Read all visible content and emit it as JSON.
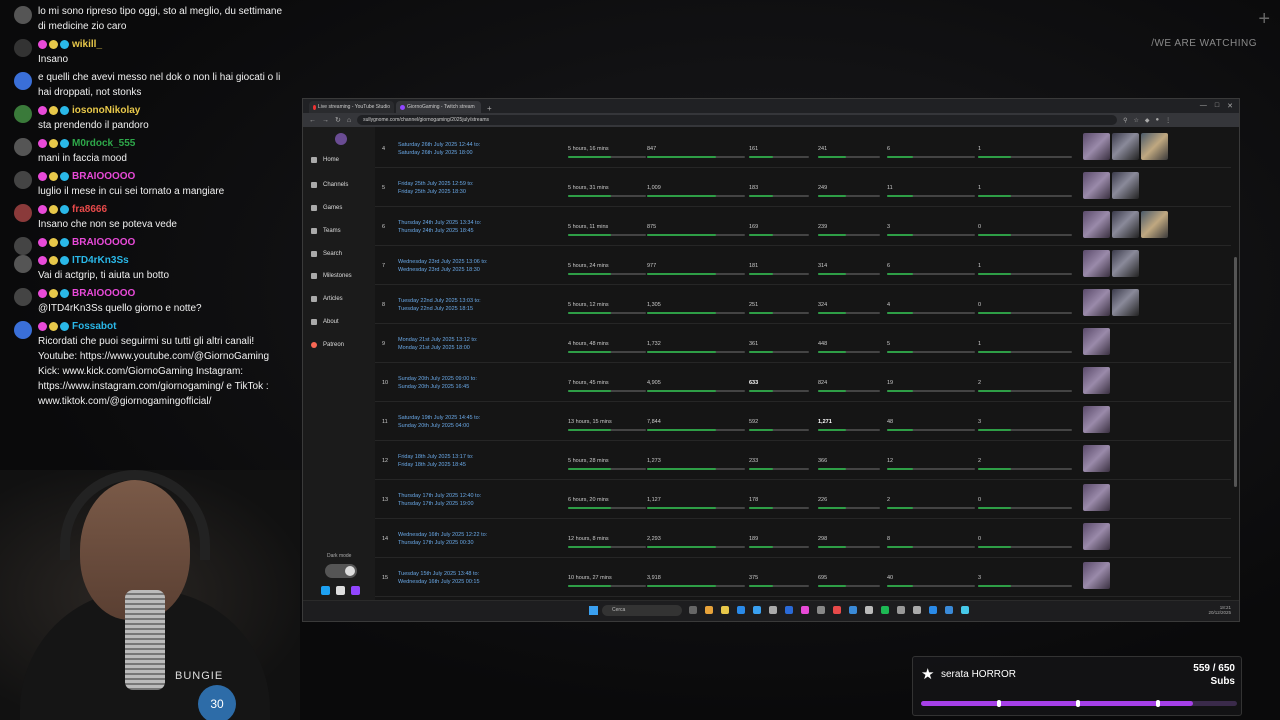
{
  "watermark": "/WE ARE WATCHING",
  "chat": [
    {
      "user": "",
      "color": "#ffffff",
      "text": "lo mi sono ripreso tipo oggi, sto al meglio, du settimane di medicine zio caro",
      "badge_color": "#555"
    },
    {
      "user": "wikill_",
      "color": "#e8c84a",
      "text": "Insano",
      "badge_color": "#333"
    },
    {
      "user": "",
      "color": "#ffffff",
      "text": "e quelli che avevi messo nel dok o non li hai giocati o li hai droppati, not stonks",
      "badge_color": "#3a6fd8"
    },
    {
      "user": "iosonoNikolay",
      "color": "#e8c84a",
      "text": "sta prendendo il pandoro",
      "badge_color": "#3a7a3a"
    },
    {
      "user": "M0rdock_555",
      "color": "#2ea84a",
      "text": "mani in faccia mood",
      "badge_color": "#555"
    },
    {
      "user": "BRAIOOOOO",
      "color": "#e84ad8",
      "text": "luglio il mese in cui sei tornato a mangiare",
      "badge_color": "#444"
    },
    {
      "user": "fra8666",
      "color": "#e84a4a",
      "text": "Insano che non se poteva vede",
      "badge_color": "#8a3a3a"
    },
    {
      "user": "BRAIOOOOO",
      "color": "#e84ad8",
      "text": "",
      "badge_color": "#444"
    },
    {
      "user": "ITD4rKn3Ss",
      "color": "#2ab8e8",
      "text": "Vai di actgrip, ti aiuta un botto",
      "badge_color": "#555"
    },
    {
      "user": "BRAIOOOOO",
      "color": "#e84ad8",
      "text": "@ITD4rKn3Ss quello giorno e notte?",
      "badge_color": "#444"
    },
    {
      "user": "Fossabot",
      "color": "#2ab8e8",
      "text": "Ricordati che puoi seguirmi su tutti gli altri canali! Youtube: https://www.youtube.com/@GiornoGaming Kick: www.kick.com/GiornoGaming Instagram: https://www.instagram.com/giornogaming/ e TikTok : www.tiktok.com/@giornogamingofficial/",
      "badge_color": "#3a6fd8"
    }
  ],
  "cam": {
    "logo": "BUNGIE",
    "badge": "30"
  },
  "browser": {
    "tabs": [
      {
        "label": "Live streaming - YouTube Studio",
        "fav": "#e33"
      },
      {
        "label": "GiornoGaming - Twitch stream",
        "fav": "#9146ff"
      }
    ],
    "new_tab": "+",
    "url": "sullygnome.com/channel/giornogaming/2025july/streams"
  },
  "sidebar": {
    "items": [
      "Home",
      "Channels",
      "Games",
      "Teams",
      "Search",
      "Milestones",
      "Articles",
      "About",
      "Patreon"
    ],
    "dark_mode": "Dark mode"
  },
  "streams": [
    {
      "n": "4",
      "start": "Saturday 26th July 2025 12:44 to:",
      "end": "Saturday 26th July 2025 18:00",
      "length": "5 hours, 16 mins",
      "avg": "847",
      "a": "161",
      "b": "241",
      "c": "6",
      "d": "1",
      "thumbs": 3
    },
    {
      "n": "5",
      "start": "Friday 25th July 2025 12:59 to:",
      "end": "Friday 25th July 2025 18:30",
      "length": "5 hours, 31 mins",
      "avg": "1,009",
      "a": "183",
      "b": "249",
      "c": "11",
      "d": "1",
      "thumbs": 2
    },
    {
      "n": "6",
      "start": "Thursday 24th July 2025 13:34 to:",
      "end": "Thursday 24th July 2025 18:45",
      "length": "5 hours, 11 mins",
      "avg": "875",
      "a": "169",
      "b": "239",
      "c": "3",
      "d": "0",
      "thumbs": 3
    },
    {
      "n": "7",
      "start": "Wednesday 23rd July 2025 13:06 to:",
      "end": "Wednesday 23rd July 2025 18:30",
      "length": "5 hours, 24 mins",
      "avg": "977",
      "a": "181",
      "b": "314",
      "c": "6",
      "d": "1",
      "thumbs": 2
    },
    {
      "n": "8",
      "start": "Tuesday 22nd July 2025 13:03 to:",
      "end": "Tuesday 22nd July 2025 18:15",
      "length": "5 hours, 12 mins",
      "avg": "1,305",
      "a": "251",
      "b": "324",
      "c": "4",
      "d": "0",
      "thumbs": 2
    },
    {
      "n": "9",
      "start": "Monday 21st July 2025 13:12 to:",
      "end": "Monday 21st July 2025 18:00",
      "length": "4 hours, 48 mins",
      "avg": "1,732",
      "a": "361",
      "b": "448",
      "c": "5",
      "d": "1",
      "thumbs": 1
    },
    {
      "n": "10",
      "start": "Sunday 20th July 2025 09:00 to:",
      "end": "Sunday 20th July 2025 16:45",
      "length": "7 hours, 45 mins",
      "avg": "4,905",
      "a": "633",
      "b": "824",
      "c": "19",
      "d": "2",
      "thumbs": 1,
      "bold_a": true
    },
    {
      "n": "11",
      "start": "Saturday 19th July 2025 14:45 to:",
      "end": "Sunday 20th July 2025 04:00",
      "length": "13 hours, 15 mins",
      "avg": "7,844",
      "a": "592",
      "b": "1,271",
      "c": "48",
      "d": "3",
      "thumbs": 1,
      "bold_b": true
    },
    {
      "n": "12",
      "start": "Friday 18th July 2025 13:17 to:",
      "end": "Friday 18th July 2025 18:45",
      "length": "5 hours, 28 mins",
      "avg": "1,273",
      "a": "233",
      "b": "366",
      "c": "12",
      "d": "2",
      "thumbs": 1
    },
    {
      "n": "13",
      "start": "Thursday 17th July 2025 12:40 to:",
      "end": "Thursday 17th July 2025 19:00",
      "length": "6 hours, 20 mins",
      "avg": "1,127",
      "a": "178",
      "b": "226",
      "c": "2",
      "d": "0",
      "thumbs": 1
    },
    {
      "n": "14",
      "start": "Wednesday 16th July 2025 12:22 to:",
      "end": "Thursday 17th July 2025 00:30",
      "length": "12 hours, 8 mins",
      "avg": "2,293",
      "a": "189",
      "b": "298",
      "c": "8",
      "d": "0",
      "thumbs": 1
    },
    {
      "n": "15",
      "start": "Tuesday 15th July 2025 13:48 to:",
      "end": "Wednesday 16th July 2025 00:15",
      "length": "10 hours, 27 mins",
      "avg": "3,918",
      "a": "375",
      "b": "695",
      "c": "40",
      "d": "3",
      "thumbs": 1
    }
  ],
  "taskbar": {
    "search": "Cerca",
    "time": "18:21",
    "date": "20/12/2025"
  },
  "goal": {
    "title": "serata HORROR",
    "count": "559 / 650",
    "unit": "Subs",
    "progress": 0.86
  }
}
